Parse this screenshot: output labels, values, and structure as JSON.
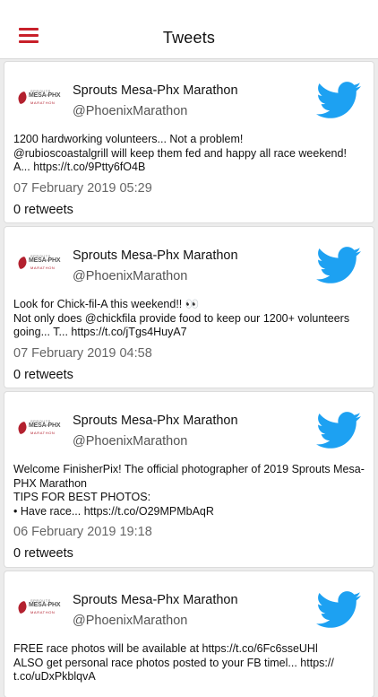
{
  "header": {
    "title": "Tweets",
    "menu_icon": "hamburger-menu-icon",
    "accent": "#c8202a"
  },
  "tweets": [
    {
      "author": "Sprouts Mesa-Phx Marathon",
      "handle": "@PhoenixMarathon",
      "text": "1200 hardworking volunteers... Not a problem!\n@rubioscoastalgrill will keep them fed and happy all race weekend!\nA... https://t.co/9Ptty6fO4B",
      "date": "07 February 2019 05:29",
      "retweets": "0 retweets"
    },
    {
      "author": "Sprouts Mesa-Phx Marathon",
      "handle": "@PhoenixMarathon",
      "text": "Look for Chick-fil-A this weekend!! 👀\nNot only does @chickfila provide food to keep our 1200+ volunteers going... T... https://t.co/jTgs4HuyA7",
      "date": "07 February 2019 04:58",
      "retweets": "0 retweets"
    },
    {
      "author": "Sprouts Mesa-Phx Marathon",
      "handle": "@PhoenixMarathon",
      "text": "Welcome FinisherPix! The official photographer of 2019 Sprouts Mesa-PHX Marathon\nTIPS FOR BEST PHOTOS:\n• Have race... https://t.co/O29MPMbAqR",
      "date": "06 February 2019 19:18",
      "retweets": "0 retweets"
    },
    {
      "author": "Sprouts Mesa-Phx Marathon",
      "handle": "@PhoenixMarathon",
      "text": "FREE race photos will be available at https://t.co/6Fc6sseUHl\nALSO get personal race photos posted to your FB timel... https://\nt.co/uDxPkblqvA",
      "date": "",
      "retweets": ""
    }
  ],
  "logo": {
    "line1": "SPROUTS",
    "line2": "MESA-PHX",
    "line3": "MARATHON"
  },
  "colors": {
    "twitter_blue": "#1da1f2",
    "brand_red": "#b3212f"
  }
}
